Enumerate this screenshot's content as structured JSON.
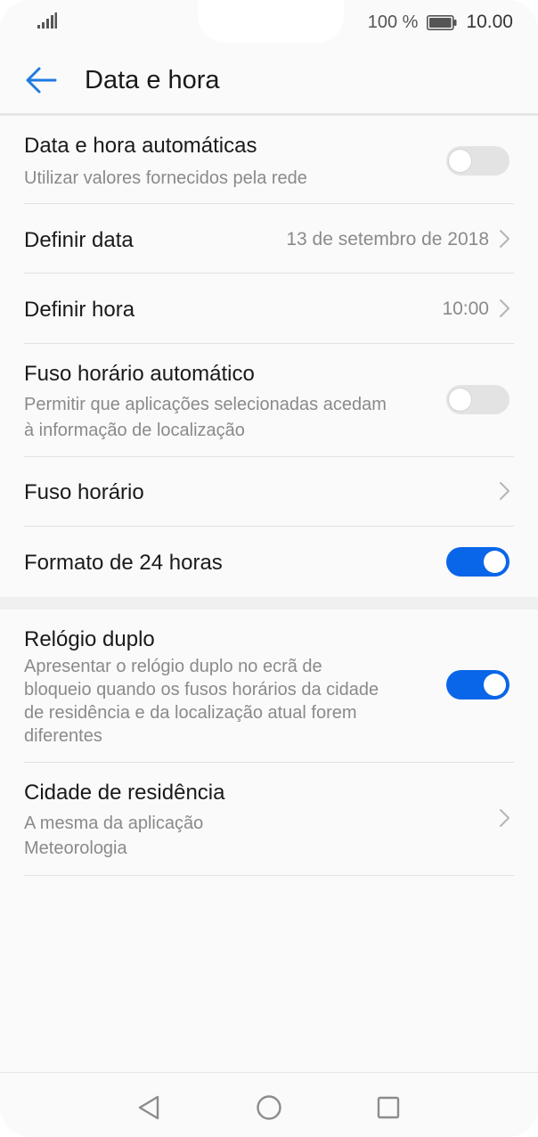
{
  "status_bar": {
    "battery_text": "100 %",
    "time": "10.00",
    "icons": [
      "signal-icon",
      "battery-icon"
    ]
  },
  "app_bar": {
    "title": "Data e hora",
    "back_icon": "arrow-left-icon",
    "accent_color": "#1e7be0"
  },
  "settings": {
    "auto_datetime": {
      "label": "Data e hora automáticas",
      "description": "Utilizar valores fornecidos pela rede",
      "enabled": false
    },
    "set_date": {
      "label": "Definir data",
      "value": "13 de setembro de 2018"
    },
    "set_time": {
      "label": "Definir hora",
      "value": "10:00"
    },
    "auto_timezone": {
      "label": "Fuso horário automático",
      "description_line1": "Permitir que aplicações selecionadas acedam",
      "description_line2": "à informação de localização",
      "enabled": false
    },
    "timezone": {
      "label": "Fuso horário"
    },
    "format_24h": {
      "label": "Formato de 24 horas",
      "enabled": true
    },
    "dual_clock": {
      "label": "Relógio duplo",
      "description_line1": "Apresentar o relógio duplo no ecrã de",
      "description_line2": "bloqueio quando os fusos horários da cidade",
      "description_line3": "de residência e da localização atual forem",
      "description_line4": "diferentes",
      "enabled": true
    },
    "home_city": {
      "label": "Cidade de residência",
      "value_line1": "A mesma da aplicação",
      "value_line2": "Meteorologia"
    }
  },
  "colors": {
    "toggle_on": "#0a66e8",
    "toggle_off": "#e3e3e3"
  },
  "nav_bar": {
    "icons": [
      "nav-back-icon",
      "nav-home-icon",
      "nav-recent-apps-icon"
    ]
  }
}
